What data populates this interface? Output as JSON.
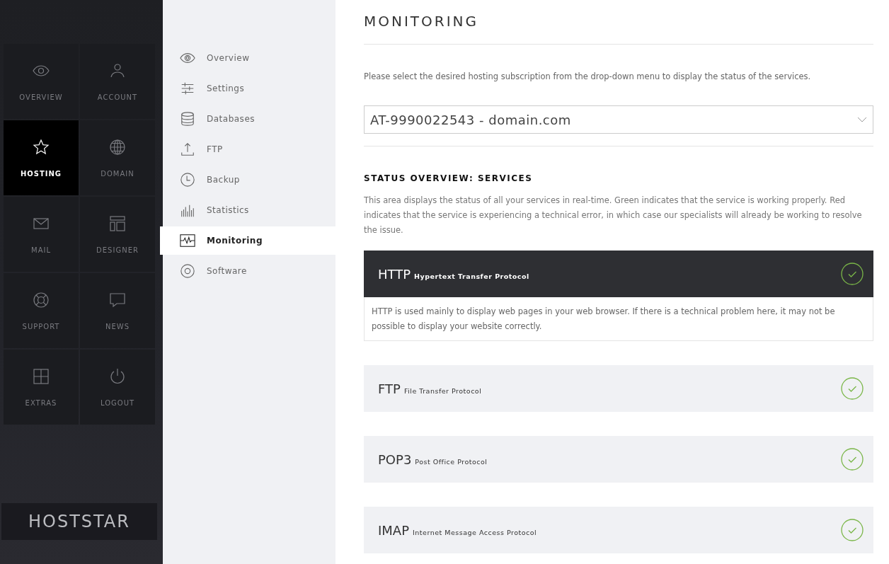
{
  "sidebar": {
    "tiles": [
      {
        "label": "OVERVIEW",
        "selected": false
      },
      {
        "label": "ACCOUNT",
        "selected": false
      },
      {
        "label": "HOSTING",
        "selected": true
      },
      {
        "label": "DOMAIN",
        "selected": false
      },
      {
        "label": "MAIL",
        "selected": false
      },
      {
        "label": "DESIGNER",
        "selected": false
      },
      {
        "label": "SUPPORT",
        "selected": false
      },
      {
        "label": "NEWS",
        "selected": false
      },
      {
        "label": "EXTRAS",
        "selected": false
      },
      {
        "label": "LOGOUT",
        "selected": false
      }
    ],
    "logo": "HOSTSTAR"
  },
  "subnav": {
    "items": [
      {
        "label": "Overview",
        "selected": false
      },
      {
        "label": "Settings",
        "selected": false
      },
      {
        "label": "Databases",
        "selected": false
      },
      {
        "label": "FTP",
        "selected": false
      },
      {
        "label": "Backup",
        "selected": false
      },
      {
        "label": "Statistics",
        "selected": false
      },
      {
        "label": "Monitoring",
        "selected": true
      },
      {
        "label": "Software",
        "selected": false
      }
    ]
  },
  "main": {
    "title": "MONITORING",
    "intro": "Please select the desired hosting subscription from the drop-down menu to display the status of the services.",
    "subscription": {
      "value": "AT-9990022543 - domain.com"
    },
    "section_title": "STATUS OVERVIEW: SERVICES",
    "section_text": "This area displays the status of all your services in real-time. Green indicates that the service is working properly. Red indicates that the service is experiencing a technical error, in which case our specialists will already be working to resolve the issue.",
    "services": [
      {
        "name": "HTTP",
        "full_name": "Hypertext Transfer Protocol",
        "working": true,
        "expanded": true,
        "description": "HTTP is used mainly to display web pages in your web browser. If there is a technical problem here, it may not be possible to display your website correctly."
      },
      {
        "name": "FTP",
        "full_name": "File Transfer Protocol",
        "working": true,
        "expanded": false
      },
      {
        "name": "POP3",
        "full_name": "Post Office Protocol",
        "working": true,
        "expanded": false
      },
      {
        "name": "IMAP",
        "full_name": "Internet Message Access Protocol",
        "working": true,
        "expanded": false
      }
    ]
  }
}
